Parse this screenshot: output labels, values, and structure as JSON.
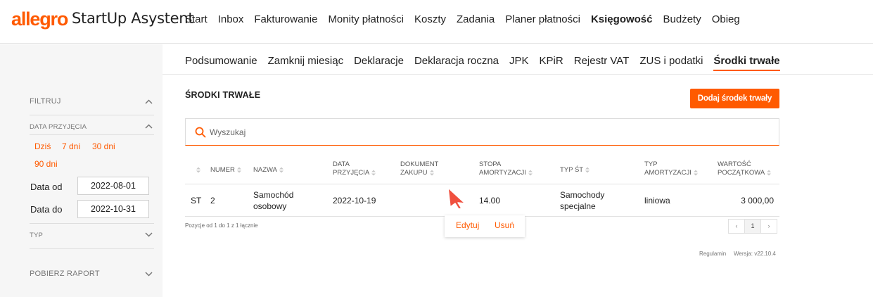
{
  "app": {
    "logo": "allegro",
    "title": "StartUp Asystent"
  },
  "main_nav": [
    {
      "label": "Start",
      "active": false
    },
    {
      "label": "Inbox",
      "active": false
    },
    {
      "label": "Fakturowanie",
      "active": false
    },
    {
      "label": "Monity płatności",
      "active": false
    },
    {
      "label": "Koszty",
      "active": false
    },
    {
      "label": "Zadania",
      "active": false
    },
    {
      "label": "Planer płatności",
      "active": false
    },
    {
      "label": "Księgowość",
      "active": true
    },
    {
      "label": "Budżety",
      "active": false
    },
    {
      "label": "Obieg",
      "active": false
    }
  ],
  "sub_nav": [
    {
      "label": "Podsumowanie",
      "active": false
    },
    {
      "label": "Zamknij miesiąc",
      "active": false
    },
    {
      "label": "Deklaracje",
      "active": false
    },
    {
      "label": "Deklaracja roczna",
      "active": false
    },
    {
      "label": "JPK",
      "active": false
    },
    {
      "label": "KPiR",
      "active": false
    },
    {
      "label": "Rejestr VAT",
      "active": false
    },
    {
      "label": "ZUS i podatki",
      "active": false
    },
    {
      "label": "Środki trwałe",
      "active": true
    }
  ],
  "sidebar": {
    "filter_title": "FILTRUJ",
    "date_section": "DATA PRZYJĘCIA",
    "quick_ranges": [
      "Dziś",
      "7 dni",
      "30 dni",
      "90 dni"
    ],
    "date_from_label": "Data od",
    "date_from_value": "2022-08-01",
    "date_to_label": "Data do",
    "date_to_value": "2022-10-31",
    "type_section": "TYP",
    "report_section": "POBIERZ RAPORT"
  },
  "content": {
    "title": "ŚRODKI TRWAŁE",
    "add_button": "Dodaj środek trwały",
    "search_placeholder": "Wyszukaj"
  },
  "table": {
    "columns": [
      {
        "line1": "",
        "line2": ""
      },
      {
        "line1": "NUMER",
        "line2": ""
      },
      {
        "line1": "NAZWA",
        "line2": ""
      },
      {
        "line1": "DATA",
        "line2": "PRZYJĘCIA"
      },
      {
        "line1": "DOKUMENT",
        "line2": "ZAKUPU"
      },
      {
        "line1": "STOPA",
        "line2": "AMORTYZACJI"
      },
      {
        "line1": "TYP ŚT",
        "line2": ""
      },
      {
        "line1": "TYP",
        "line2": "AMORTYZACJI"
      },
      {
        "line1": "WARTOŚĆ",
        "line2": "POCZĄTKOWA"
      }
    ],
    "rows": [
      {
        "type": "ST",
        "number": "2",
        "name_line1": "Samochód",
        "name_line2": "osobowy",
        "date": "2022-10-19",
        "document": "",
        "rate": "14.00",
        "asset_type_line1": "Samochody",
        "asset_type_line2": "specjalne",
        "depreciation_type": "liniowa",
        "initial_value": "3 000,00"
      }
    ],
    "row_actions": [
      "Edytuj",
      "Usuń"
    ],
    "pagination_info": "Pozycje od 1 do 1 z 1 łącznie",
    "pages": [
      "‹",
      "1",
      "›"
    ],
    "current_page": "1"
  },
  "footer": {
    "terms": "Regulamin",
    "version": "Wersja: v22.10.4"
  },
  "colors": {
    "accent": "#ff5a00",
    "sidebar_bg": "#f6f6f6",
    "text": "#222222"
  }
}
